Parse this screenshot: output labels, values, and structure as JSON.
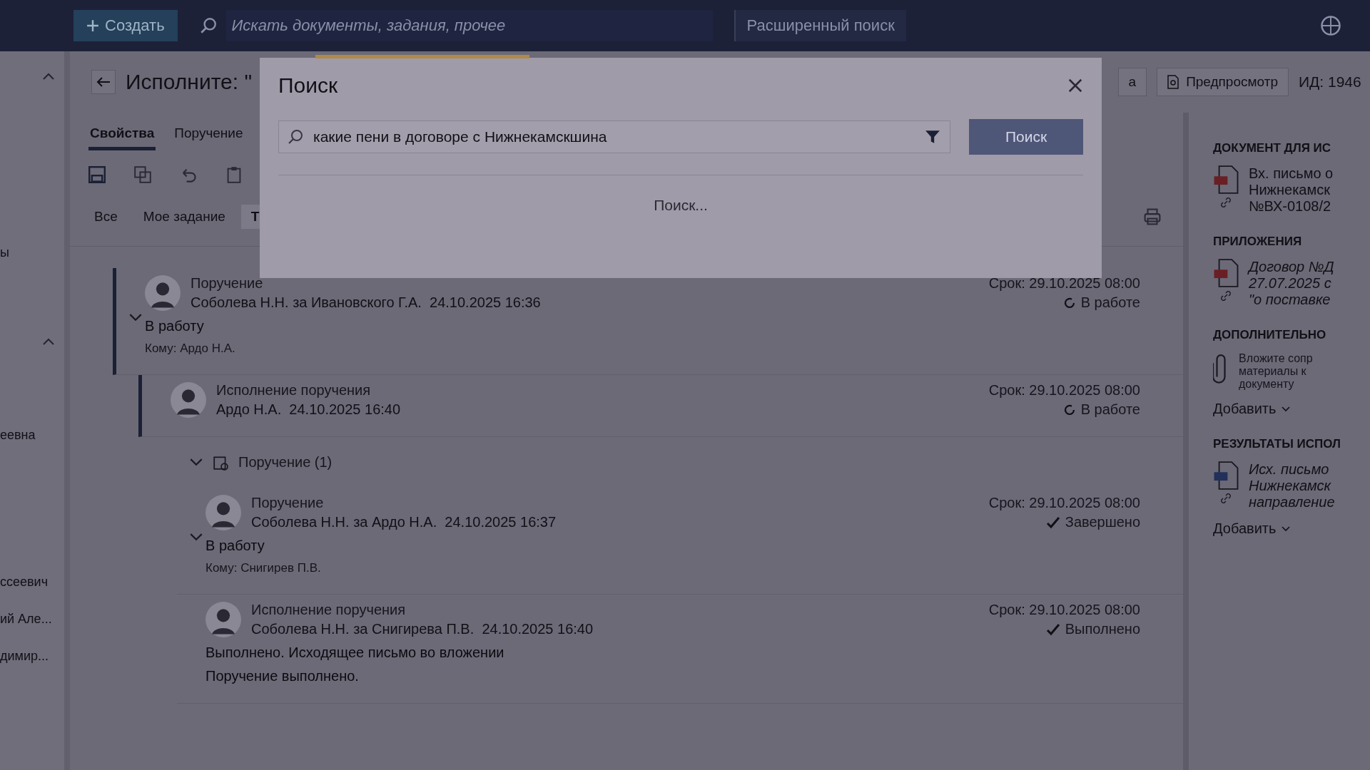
{
  "top_bar": {
    "create_button": "Создать",
    "search": {
      "placeholder": "Искать документы, задания, прочее"
    },
    "advanced_search": "Расширенный поиск"
  },
  "sidebar": {
    "items": [
      {
        "label": "ы"
      },
      {
        "label": "еевна"
      },
      {
        "label": "ссеевич"
      },
      {
        "label": "ий Але..."
      },
      {
        "label": "димир..."
      }
    ]
  },
  "document": {
    "title": "Исполните: \"",
    "actions": [
      {
        "label": "а"
      },
      {
        "label": "Предпросмотр"
      }
    ],
    "id": "ИД: 1946"
  },
  "tabs": [
    {
      "label": "Свойства",
      "selected": true
    },
    {
      "label": "Поручение",
      "selected": false
    }
  ],
  "filters": [
    {
      "label": "Все",
      "selected": false
    },
    {
      "label": "Мое задание",
      "selected": false
    },
    {
      "label": "Т",
      "selected": true
    }
  ],
  "feed": [
    {
      "kind": "task",
      "type": "Поручение",
      "author": "Соболева Н.Н. за Ивановского Г.А.",
      "date": "24.10.2025 16:36",
      "text": "В работу",
      "to": "Кому: Ардо Н.А.",
      "deadline": "Срок: 29.10.2025 08:00",
      "status": {
        "kind": "in_progress",
        "label": "В работе"
      },
      "children": [
        {
          "kind": "task",
          "type": "Исполнение поручения",
          "author": "Ардо Н.А.",
          "date": "24.10.2025 16:40",
          "deadline": "Срок: 29.10.2025 08:00",
          "status": {
            "kind": "in_progress",
            "label": "В работе"
          },
          "children": [
            {
              "kind": "group",
              "label": "Поручение (1)",
              "expanded": true,
              "children": [
                {
                  "kind": "task",
                  "type": "Поручение",
                  "author": "Соболева Н.Н. за Ардо Н.А.",
                  "date": "24.10.2025 16:37",
                  "text": "В работу",
                  "to": "Кому: Снигирев П.В.",
                  "deadline": "Срок: 29.10.2025 08:00",
                  "status": {
                    "kind": "done",
                    "label": "Завершено"
                  }
                },
                {
                  "kind": "task",
                  "type": "Исполнение поручения",
                  "author": "Соболева Н.Н. за Снигирева П.В.",
                  "date": "24.10.2025 16:40",
                  "text": "Выполнено. Исходящее письмо во вложении",
                  "note": "Поручение выполнено.",
                  "deadline": "Срок: 29.10.2025 08:00",
                  "status": {
                    "kind": "done",
                    "label": "Выполнено"
                  }
                }
              ]
            }
          ]
        }
      ]
    }
  ],
  "right_panel": {
    "sections": [
      {
        "heading": "ДОКУМЕНТ ДЛЯ ИС",
        "files": [
          {
            "kind": "pdf",
            "italic": false,
            "lines": [
              "Вх. письмо о",
              "Нижнекамск",
              "№ВХ-0108/2"
            ]
          }
        ]
      },
      {
        "heading": "ПРИЛОЖЕНИЯ",
        "files": [
          {
            "kind": "pdf",
            "italic": true,
            "lines": [
              "Договор №Д",
              "27.07.2025 с",
              "\"о поставке"
            ]
          }
        ]
      },
      {
        "heading": "ДОПОЛНИТЕЛЬНО",
        "hint": [
          "Вложите сопр",
          "материалы к",
          "документу"
        ],
        "add": "Добавить"
      },
      {
        "heading": "РЕЗУЛЬТАТЫ ИСПОЛ",
        "files": [
          {
            "kind": "word",
            "italic": true,
            "lines": [
              "Исх. письмо",
              "Нижнекамск",
              "направление"
            ]
          }
        ],
        "add": "Добавить"
      }
    ]
  },
  "modal": {
    "title": "Поиск",
    "query": "какие пени в договоре с Нижнекамскшина",
    "button": "Поиск",
    "status": "Поиск..."
  }
}
